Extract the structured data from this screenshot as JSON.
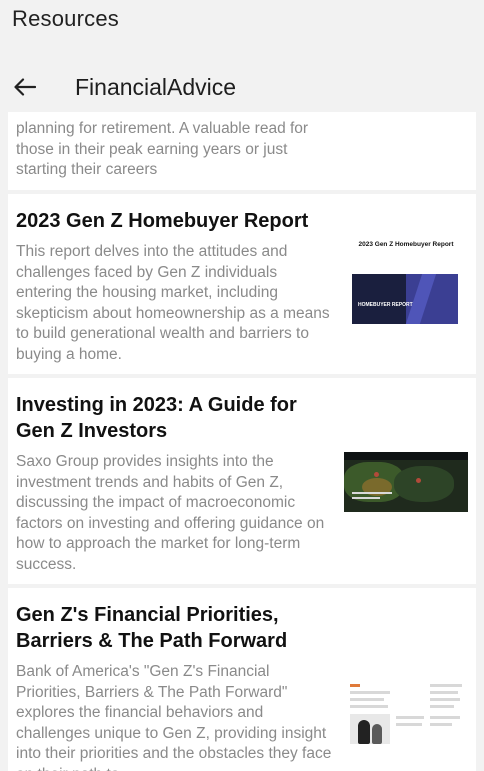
{
  "app": {
    "title": "Resources"
  },
  "header": {
    "back_icon": "arrow-left-icon",
    "title": "FinancialAdvice"
  },
  "feed": {
    "partial_card": {
      "description": "planning for retirement. A valuable read for those in their peak earning years or just starting their careers"
    },
    "cards": [
      {
        "title": "2023 Gen Z Homebuyer Report",
        "description": "This report delves into the attitudes and challenges faced by Gen Z individuals entering the housing market, including skepticism about homeownership as a means to build generational wealth and barriers to buying a home.",
        "thumbnail": {
          "caption": "2023 Gen Z Homebuyer Report",
          "cover_label": "HOMEBUYER REPORT"
        }
      },
      {
        "title": "Investing in 2023: A Guide for Gen Z Investors",
        "description": "Saxo Group provides insights into the investment trends and habits of Gen Z, discussing the impact of macroeconomic factors on investing and offering guidance on how to approach the market for long-term success."
      },
      {
        "title": "Gen Z's Financial Priorities, Barriers & The Path Forward",
        "description": "Bank of America's \"Gen Z's Financial Priorities, Barriers & The Path Forward\" explores the financial behaviors and challenges unique to Gen Z, providing insight into their priorities and the obstacles they face on their path to"
      }
    ]
  },
  "colors": {
    "background": "#f2f2f2",
    "card": "#ffffff",
    "title_text": "#111111",
    "body_text": "#8a8a8a",
    "cover_navy": "#1a1f3e",
    "cover_purple": "#3b3f93"
  }
}
